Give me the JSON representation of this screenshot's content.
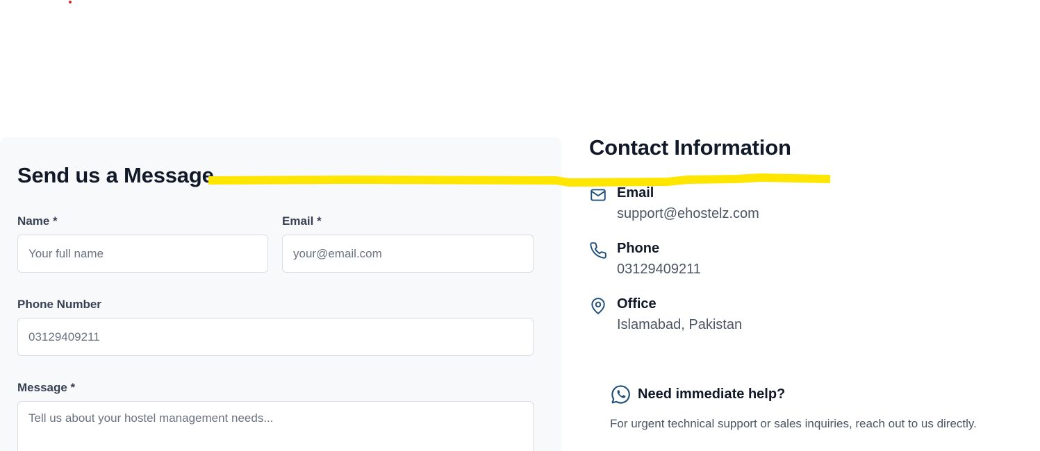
{
  "colors": {
    "accent": "#1f4e79",
    "form_background": "#f8f9fb",
    "annotation_highlight": "#ffe600",
    "dot": "#dc2626"
  },
  "form": {
    "title": "Send us a Message",
    "name": {
      "label": "Name *",
      "placeholder": "Your full name",
      "value": ""
    },
    "email": {
      "label": "Email *",
      "placeholder": "your@email.com",
      "value": ""
    },
    "phone": {
      "label": "Phone Number",
      "placeholder": "03129409211",
      "value": ""
    },
    "message": {
      "label": "Message *",
      "placeholder": "Tell us about your hostel management needs...",
      "value": ""
    }
  },
  "contact": {
    "title": "Contact Information",
    "items": [
      {
        "icon": "mail-icon",
        "label": "Email",
        "value": "support@ehostelz.com"
      },
      {
        "icon": "phone-icon",
        "label": "Phone",
        "value": "03129409211"
      },
      {
        "icon": "map-pin-icon",
        "label": "Office",
        "value": "Islamabad, Pakistan"
      }
    ],
    "help": {
      "icon": "whatsapp-icon",
      "title": "Need immediate help?",
      "text": "For urgent technical support or sales inquiries, reach out to us directly."
    }
  }
}
